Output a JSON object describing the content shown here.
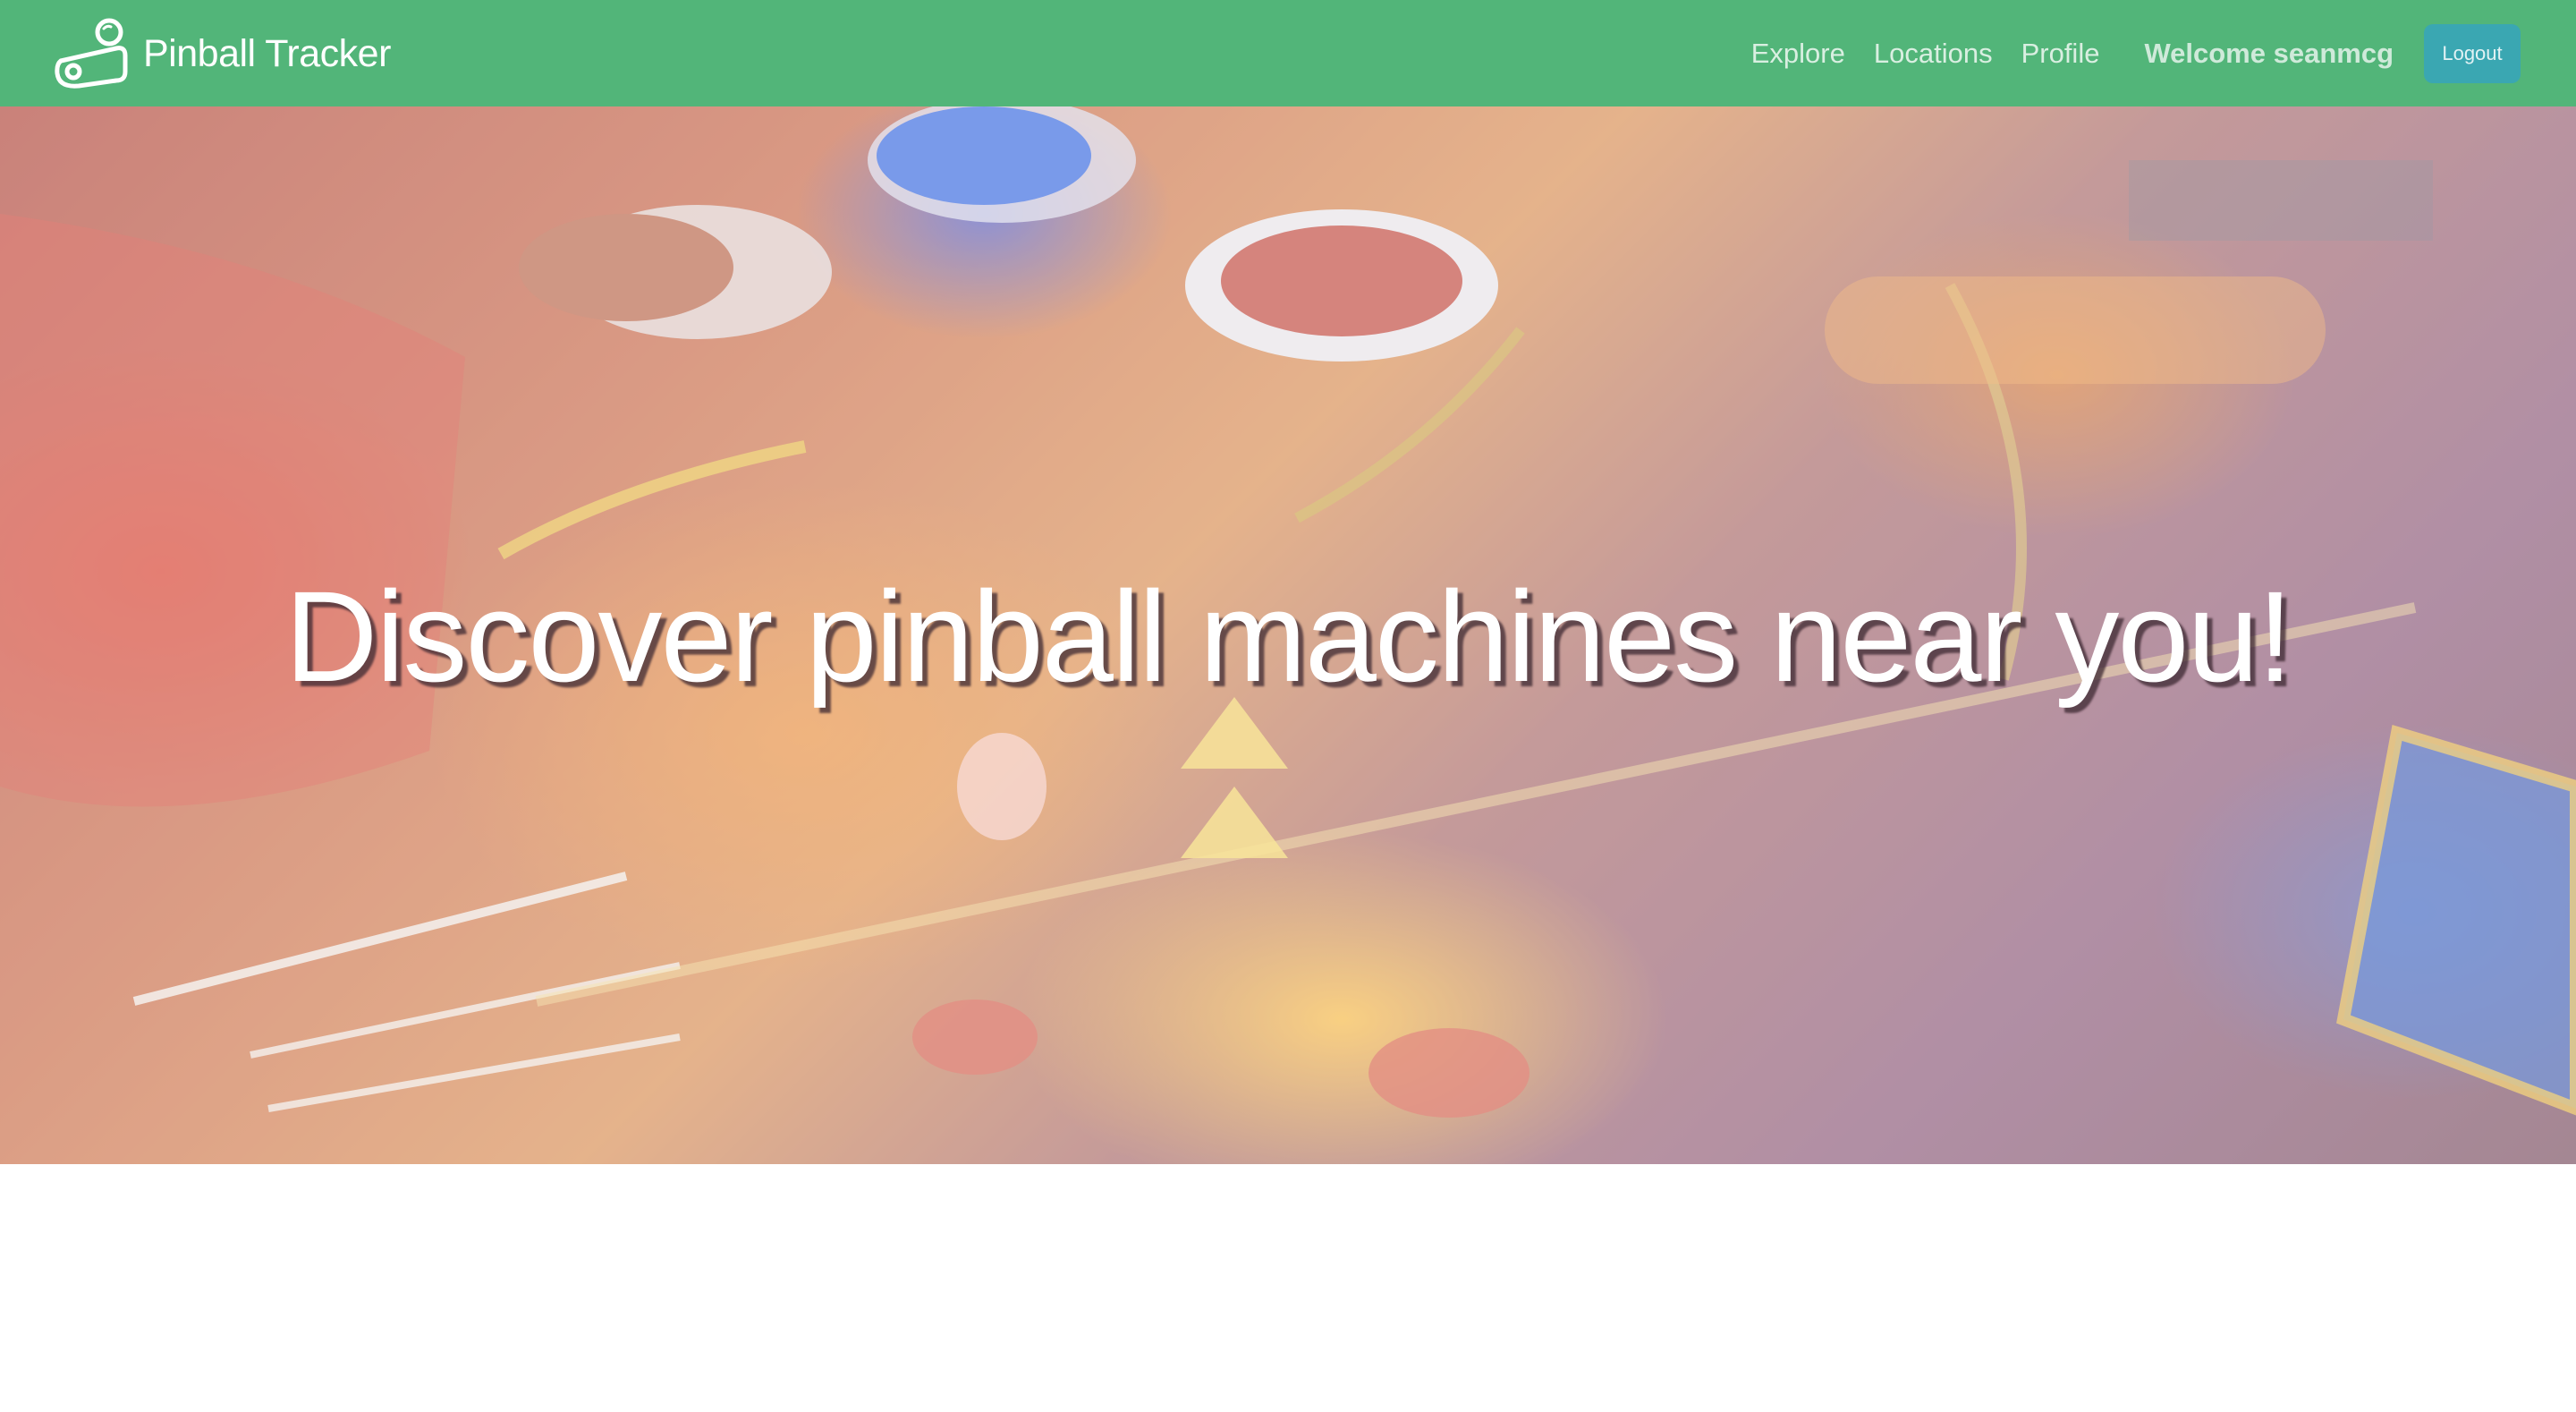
{
  "navbar": {
    "brand_name": "Pinball Tracker",
    "brand_icon": "pinball-flipper-icon",
    "links": {
      "explore": "Explore",
      "locations": "Locations",
      "profile": "Profile"
    },
    "welcome_text": "Welcome seanmcg",
    "logout_label": "Logout"
  },
  "hero": {
    "title": "Discover pinball machines near you!"
  },
  "colors": {
    "navbar_background": "#52b579",
    "logout_button": "#3aa7b2",
    "hero_text": "#ffffff"
  }
}
